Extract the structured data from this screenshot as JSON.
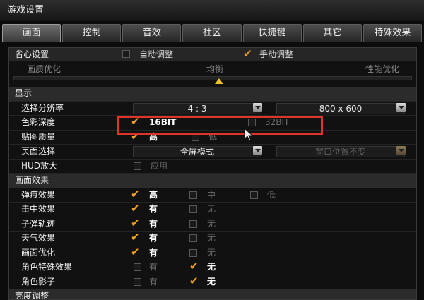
{
  "window": {
    "title": "游戏设置"
  },
  "tabs": [
    "画面",
    "控制",
    "音效",
    "社区",
    "快捷键",
    "其它",
    "特殊效果"
  ],
  "active_tab": 0,
  "quick": {
    "label": "省心设置",
    "auto_label": "自动调整",
    "manual_label": "手动调整",
    "manual_checked": true,
    "slider_left": "画质优化",
    "slider_mid": "均衡",
    "slider_right": "性能优化"
  },
  "display": {
    "title": "显示",
    "resolution_label": "选择分辨率",
    "aspect_value": "4 : 3",
    "resolution_value": "800 x 600",
    "color_depth_label": "色彩深度",
    "color_16": "16BIT",
    "color_32": "32BIT",
    "texture_label": "贴图质量",
    "texture_high": "高",
    "texture_low": "低",
    "page_label": "页面选择",
    "page_mode": "全屏模式",
    "window_pos": "窗口位置不变",
    "hud_label": "HUD放大",
    "hud_apply": "应用"
  },
  "effects": {
    "title": "画面效果",
    "rows": [
      {
        "label": "弹痕效果",
        "opts": [
          "高",
          "中",
          "低"
        ],
        "selected": 0
      },
      {
        "label": "击中效果",
        "opts": [
          "有",
          "无"
        ],
        "selected": 0
      },
      {
        "label": "子弹轨迹",
        "opts": [
          "有",
          "无"
        ],
        "selected": 0
      },
      {
        "label": "天气效果",
        "opts": [
          "有",
          "无"
        ],
        "selected": 0
      },
      {
        "label": "画面优化",
        "opts": [
          "有",
          "无"
        ],
        "selected": 0
      },
      {
        "label": "角色特殊效果",
        "opts": [
          "有",
          "无"
        ],
        "selected": 1
      },
      {
        "label": "角色影子",
        "opts": [
          "有",
          "无"
        ],
        "selected": 1
      }
    ]
  },
  "brightness": {
    "title": "亮度调整"
  },
  "colors": {
    "accent_check": "#f3a21a",
    "highlight_box": "#e0342b",
    "slider_thumb": "#f2c230"
  }
}
